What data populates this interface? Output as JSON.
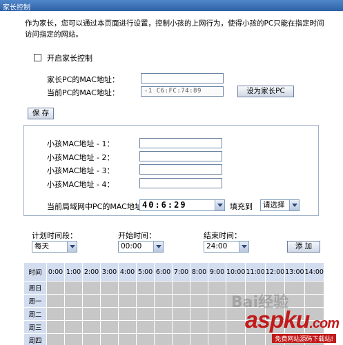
{
  "window": {
    "title": "家长控制"
  },
  "description": "作为家长，您可以通过本页面进行设置，控制小孩的上网行为，使得小孩的PC只能在指定时间访问指定的网站。",
  "enable": {
    "label": "开启家长控制",
    "checked": false
  },
  "parent": {
    "pc_mac_label": "家长PC的MAC地址：",
    "pc_mac_value": "",
    "current_mac_label": "当前PC的MAC地址：",
    "current_mac_value": "-1 C6:FC:74:89",
    "set_parent_button": "设为家长PC"
  },
  "save_button": "保 存",
  "children": {
    "mac_labels": [
      "小孩MAC地址 - 1：",
      "小孩MAC地址 - 2：",
      "小孩MAC地址 - 3：",
      "小孩MAC地址 - 4："
    ],
    "lan_label": "当前局域网中PC的MAC地址：",
    "lan_select_value": "40:6:29",
    "fill_to_label": "填充到",
    "fill_select_value": "请选择"
  },
  "schedule": {
    "period_label": "计划时间段：",
    "period_value": "每天",
    "start_label": "开始时间：",
    "start_value": "00:00",
    "end_label": "结束时间：",
    "end_value": "24:00",
    "add_button": "添 加",
    "time_header": "时间",
    "hours": [
      "0:00",
      "1:00",
      "2:00",
      "3:00",
      "4:00",
      "5:00",
      "6:00",
      "7:00",
      "8:00",
      "9:00",
      "10:00",
      "11:00",
      "12:00",
      "13:00",
      "14:00"
    ],
    "days": [
      "周日",
      "周一",
      "周二",
      "周三",
      "周四"
    ]
  },
  "watermark": {
    "brand_a": "asp",
    "brand_b": "ku",
    "brand_c": ".com",
    "sub": "免费网站源码下载站!"
  },
  "baidu": "Bai经验"
}
